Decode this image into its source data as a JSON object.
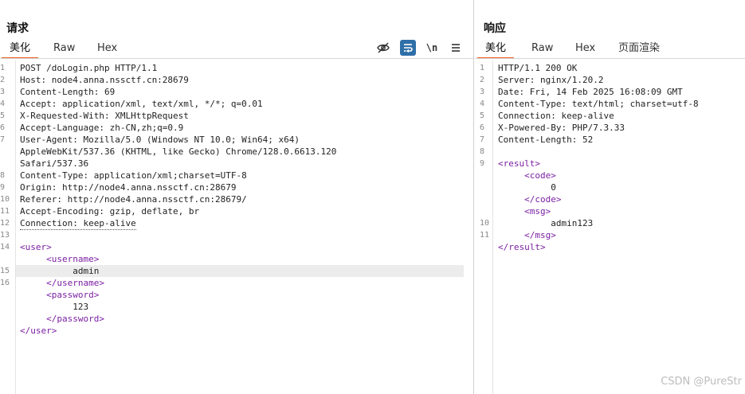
{
  "request": {
    "title": "请求",
    "tabs": [
      "美化",
      "Raw",
      "Hex"
    ],
    "active_tab": "美化",
    "tools": {
      "hide_icon": "eye-slash-icon",
      "wrap_icon": "wrap-lines-icon",
      "newline_label": "\\n",
      "menu_icon": "hamburger-menu-icon"
    },
    "lines": [
      {
        "no": "1",
        "text": "POST /doLogin.php HTTP/1.1"
      },
      {
        "no": "2",
        "text": "Host: node4.anna.nssctf.cn:28679"
      },
      {
        "no": "3",
        "text": "Content-Length: 69"
      },
      {
        "no": "4",
        "text": "Accept: application/xml, text/xml, */*; q=0.01"
      },
      {
        "no": "5",
        "text": "X-Requested-With: XMLHttpRequest"
      },
      {
        "no": "6",
        "text": "Accept-Language: zh-CN,zh;q=0.9"
      },
      {
        "no": "7",
        "text": "User-Agent: Mozilla/5.0 (Windows NT 10.0; Win64; x64)"
      },
      {
        "no": "",
        "text": "AppleWebKit/537.36 (KHTML, like Gecko) Chrome/128.0.6613.120"
      },
      {
        "no": "",
        "text": "Safari/537.36"
      },
      {
        "no": "8",
        "text": "Content-Type: application/xml;charset=UTF-8"
      },
      {
        "no": "9",
        "text": "Origin: http://node4.anna.nssctf.cn:28679"
      },
      {
        "no": "10",
        "text": "Referer: http://node4.anna.nssctf.cn:28679/"
      },
      {
        "no": "11",
        "text": "Accept-Encoding: gzip, deflate, br"
      },
      {
        "no": "12",
        "text": "Connection: keep-alive"
      },
      {
        "no": "13",
        "text": ""
      },
      {
        "no": "14",
        "text": "<user>"
      },
      {
        "no": "",
        "text": "     <username>"
      },
      {
        "no": "15",
        "text": "          admin"
      },
      {
        "no": "16",
        "text": "     </username>"
      },
      {
        "no": "",
        "text": "     <password>"
      },
      {
        "no": "",
        "text": "          123"
      },
      {
        "no": "",
        "text": "     </password>"
      },
      {
        "no": "",
        "text": "</user>"
      }
    ]
  },
  "response": {
    "title": "响应",
    "tabs": [
      "美化",
      "Raw",
      "Hex",
      "页面渲染"
    ],
    "active_tab": "美化",
    "lines": [
      {
        "no": "1",
        "text": "HTTP/1.1 200 OK"
      },
      {
        "no": "2",
        "text": "Server: nginx/1.20.2"
      },
      {
        "no": "3",
        "text": "Date: Fri, 14 Feb 2025 16:08:09 GMT"
      },
      {
        "no": "4",
        "text": "Content-Type: text/html; charset=utf-8"
      },
      {
        "no": "5",
        "text": "Connection: keep-alive"
      },
      {
        "no": "6",
        "text": "X-Powered-By: PHP/7.3.33"
      },
      {
        "no": "7",
        "text": "Content-Length: 52"
      },
      {
        "no": "8",
        "text": ""
      },
      {
        "no": "9",
        "text": "<result>"
      },
      {
        "no": "",
        "text": "     <code>"
      },
      {
        "no": "",
        "text": "          0"
      },
      {
        "no": "",
        "text": "     </code>"
      },
      {
        "no": "",
        "text": "     <msg>"
      },
      {
        "no": "10",
        "text": "          admin123"
      },
      {
        "no": "11",
        "text": "     </msg>"
      },
      {
        "no": "",
        "text": "</result>"
      }
    ]
  },
  "watermark": "CSDN @PureStr",
  "colors": {
    "accent": "#e8601c",
    "tag": "#7a1fa2",
    "wrap_button": "#2f6fa8"
  }
}
